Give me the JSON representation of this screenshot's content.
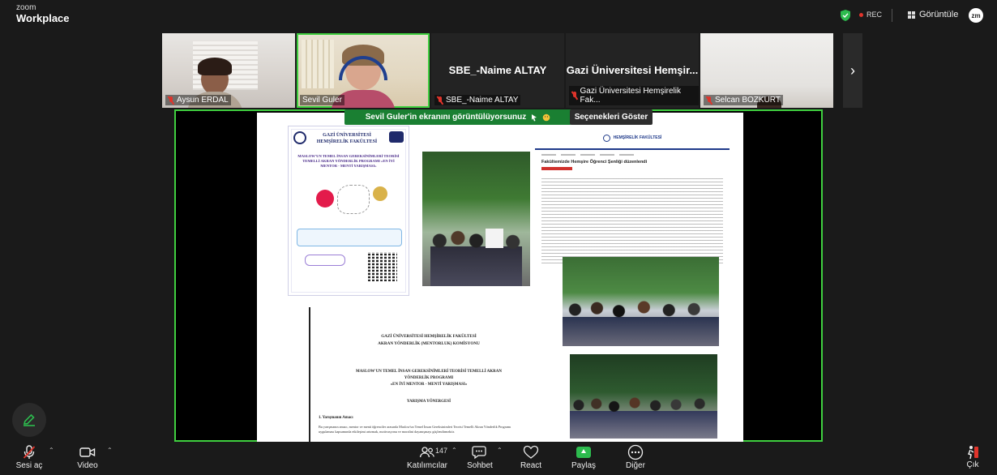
{
  "brand": {
    "small": "zoom",
    "big": "Workplace"
  },
  "header": {
    "rec_label": "REC",
    "view_label": "Görüntüle",
    "avatar_initials": "zm"
  },
  "participants": [
    {
      "name": "Aysun ERDAL",
      "muted": true,
      "video": true
    },
    {
      "name": "Sevil Guler",
      "muted": false,
      "video": true,
      "active": true
    },
    {
      "name": "SBE_-Naime ALTAY",
      "display_name": "SBE_-Naime ALTAY",
      "muted": true,
      "video": false
    },
    {
      "name": "Gazi Üniversitesi Hemşirelik Fak...",
      "display_name": "Gazi Üniversitesi Hemşir...",
      "muted": true,
      "video": false
    },
    {
      "name": "Selcan BOZKURT",
      "muted": true,
      "video": true
    }
  ],
  "share_banner": {
    "text": "Sevil Guler'in ekranını görüntülüyorsunuz",
    "options_label": "Seçenekleri Göster"
  },
  "shared_content": {
    "poster": {
      "faculty": "GAZİ ÜNİVERSİTESİ HEMŞİRELİK FAKÜLTESİ",
      "title": "MASLOW'UN TEMEL İNSAN GEREKSİNİMLERİ TEORİSİ TEMELLİ AKRAN YÖNDERLİK PROGRAMI «EN İYİ MENTOR - MENTİ YARIŞMASI»"
    },
    "news_site": {
      "header": "HEMŞİRELİK FAKÜLTESİ",
      "headline": "Fakültemizde Hemşire Öğrenci Şenliği düzenlendi"
    },
    "document": {
      "org_line1": "GAZİ ÜNİVERSİTESİ HEMŞİRELİK FAKÜLTESİ",
      "org_line2": "AKRAN YÖNDERLİK (MENTORLUK) KOMİSYONU",
      "title_line1": "MASLOW'UN TEMEL İNSAN GEREKSİNİMLERİ TEORİSİ TEMELLİ AKRAN",
      "title_line2": "YÖNDERLİK PROGRAMI",
      "title_line3": "«EN İYİ MENTOR - MENTİ YARIŞMASI»",
      "subtitle": "YARIŞMA YÖNERGESİ",
      "section": "1. Yarışmanın Amacı",
      "body": "Bu yarışmanın amacı, mentor ve menti öğrenciler arasında Maslow'un Temel İnsan Gereksinimleri Teorisi Temelli Akran Yönderlik Programı uygulaması kapsamında etkileşimi artırmak, motivasyonu ve moralini dayanışmayı güçlendirmektir."
    }
  },
  "toolbar": {
    "mute_label": "Sesi aç",
    "video_label": "Video",
    "participants_label": "Katılımcılar",
    "participants_count": "147",
    "chat_label": "Sohbet",
    "react_label": "React",
    "share_label": "Paylaş",
    "more_label": "Diğer",
    "leave_label": "Çık"
  },
  "colors": {
    "active_speaker": "#3fcf3f",
    "share_green": "#1a7f32",
    "muted_red": "#e0342b"
  }
}
